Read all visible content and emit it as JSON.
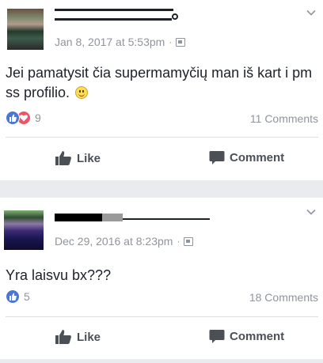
{
  "posts": [
    {
      "date": "Jan 8, 2017 at 5:53pm",
      "separator": "·",
      "text": "Jei pamatysit čia supermamyčių man iš kart i pm ss profilio.",
      "reaction_count": "9",
      "comments": "11 Comments",
      "like_label": "Like",
      "comment_label": "Comment"
    },
    {
      "date": "Dec 29, 2016 at 8:23pm",
      "separator": "·",
      "text": "Yra laisvu bx???",
      "reaction_count": "5",
      "comments": "18 Comments",
      "like_label": "Like",
      "comment_label": "Comment"
    }
  ],
  "colors": {
    "page_bg": "#e9ebee",
    "meta_text": "#90949c",
    "like_blue": "#4a77d4",
    "love_red": "#f25268",
    "action_text": "#4b4f56"
  },
  "icons": [
    "chevron-down-icon",
    "globe-icon",
    "smile-emoji-icon",
    "like-reaction-icon",
    "love-reaction-icon",
    "thumbs-up-icon",
    "comment-icon"
  ]
}
